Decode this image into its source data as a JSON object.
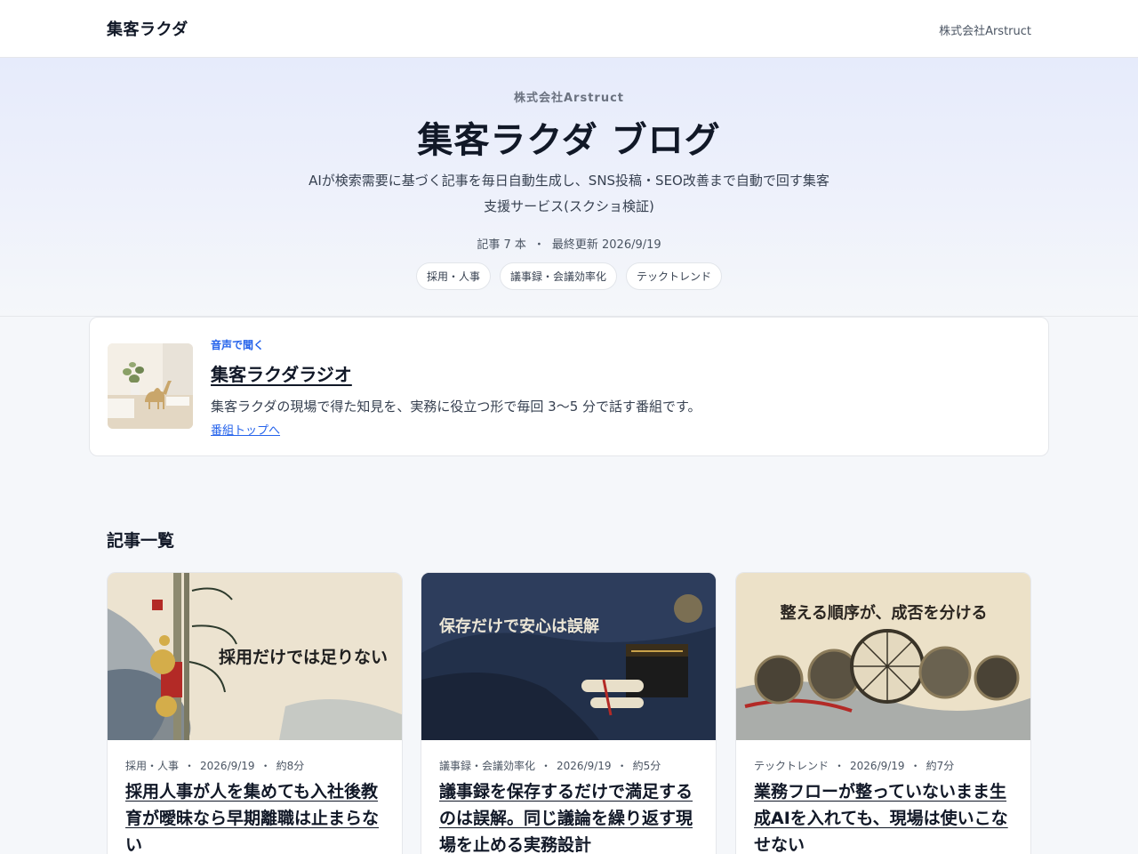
{
  "header": {
    "brand": "集客ラクダ",
    "company_link": "株式会社Arstruct"
  },
  "hero": {
    "kicker": "株式会社Arstruct",
    "title": "集客ラクダ ブログ",
    "description": "AIが検索需要に基づく記事を毎日自動生成し、SNS投稿・SEO改善まで自動で回す集客支援サービス(スクショ検証)",
    "article_count": "記事 7 本",
    "meta_sep": "・",
    "last_updated": "最終更新 2026/9/19",
    "tags": [
      "採用・人事",
      "議事録・会議効率化",
      "テックトレンド"
    ]
  },
  "radio": {
    "kicker": "音声で聞く",
    "title": "集客ラクダラジオ",
    "description": "集客ラクダの現場で得た知見を、実務に役立つ形で毎回 3〜5 分で話す番組です。",
    "link": "番組トップへ"
  },
  "section": {
    "title": "記事一覧"
  },
  "articles": [
    {
      "image_text": "採用だけでは足りない",
      "category": "採用・人事",
      "date": "2026/9/19",
      "read_time": "約8分",
      "title": "採用人事が人を集めても入社後教育が曖昧なら早期離職は止まらない"
    },
    {
      "image_text": "保存だけで安心は誤解",
      "category": "議事録・会議効率化",
      "date": "2026/9/19",
      "read_time": "約5分",
      "title": "議事録を保存するだけで満足するのは誤解。同じ議論を繰り返す現場を止める実務設計"
    },
    {
      "image_text": "整える順序が、成否を分ける",
      "category": "テックトレンド",
      "date": "2026/9/19",
      "read_time": "約7分",
      "title": "業務フローが整っていないまま生成AIを入れても、現場は使いこなせない"
    }
  ],
  "meta_separator": "・",
  "colors": {
    "accent": "#2563eb",
    "text": "#111827",
    "muted": "#4b5563",
    "background": "#f5f7fa"
  }
}
